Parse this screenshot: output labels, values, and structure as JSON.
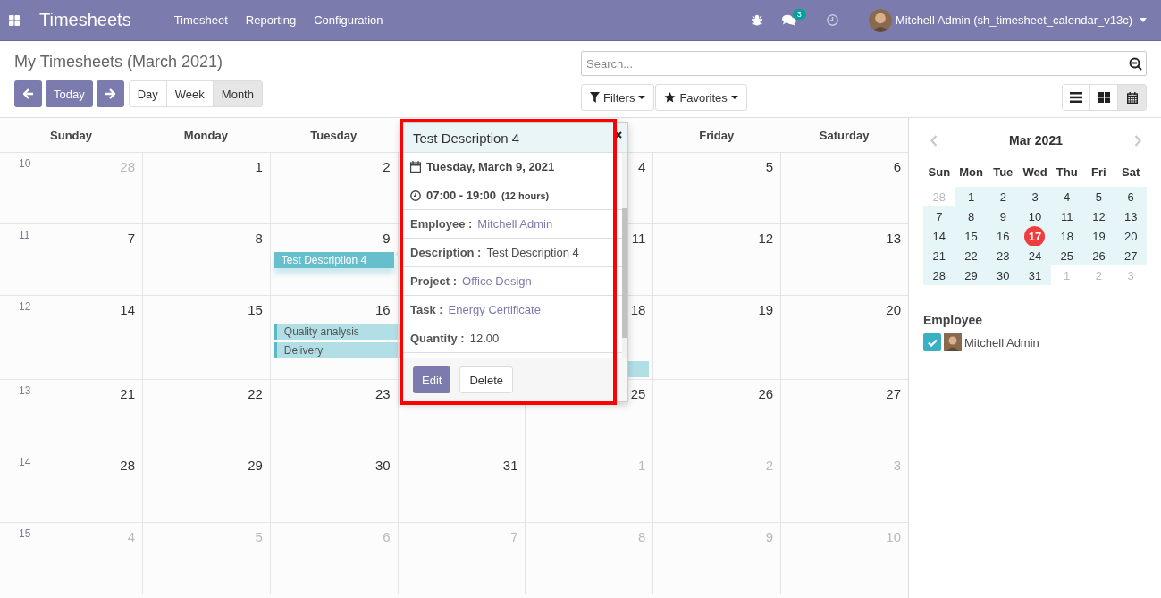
{
  "navbar": {
    "app_title": "Timesheets",
    "menu": [
      "Timesheet",
      "Reporting",
      "Configuration"
    ],
    "messages_badge": "3",
    "user": "Mitchell Admin (sh_timesheet_calendar_v13c)"
  },
  "control_panel": {
    "title": "My Timesheets (March 2021)",
    "today_button": "Today",
    "scales": [
      {
        "label": "Day",
        "selected": false
      },
      {
        "label": "Week",
        "selected": false
      },
      {
        "label": "Month",
        "selected": true
      }
    ],
    "search": {
      "placeholder": "Search..."
    },
    "filters": "Filters",
    "favorites": "Favorites",
    "views": [
      {
        "kind": "list",
        "selected": false
      },
      {
        "kind": "kanban",
        "selected": false
      },
      {
        "kind": "calendar",
        "selected": true
      }
    ]
  },
  "calendar": {
    "weekdays_before_popover": [
      "Sunday",
      "Monday",
      "Tuesday"
    ],
    "weekdays_after_popover": [
      "Friday",
      "Saturday"
    ],
    "weeks": [
      {
        "number": "10",
        "days": [
          {
            "label": "28",
            "kind": "other"
          },
          {
            "label": "1",
            "kind": "current"
          },
          {
            "label": "2",
            "kind": "current"
          },
          {
            "kind": "covered"
          },
          {
            "label": "4",
            "kind": "current"
          },
          {
            "label": "5",
            "kind": "current"
          },
          {
            "label": "6",
            "kind": "current"
          }
        ]
      },
      {
        "number": "11",
        "days": [
          {
            "label": "7",
            "kind": "current"
          },
          {
            "label": "8",
            "kind": "current"
          },
          {
            "label": "9",
            "kind": "current",
            "events": [
              {
                "title": "Test Description 4",
                "kind": "selected"
              }
            ]
          },
          {
            "kind": "covered"
          },
          {
            "label": "11",
            "kind": "current"
          },
          {
            "label": "12",
            "kind": "current"
          },
          {
            "label": "13",
            "kind": "current"
          }
        ]
      },
      {
        "number": "12",
        "days": [
          {
            "label": "14",
            "kind": "current"
          },
          {
            "label": "15",
            "kind": "current"
          },
          {
            "label": "16",
            "kind": "current",
            "events": [
              {
                "title": "Quality analysis",
                "kind": "normal"
              },
              {
                "title": "Delivery",
                "kind": "normal"
              }
            ]
          },
          {
            "kind": "covered"
          },
          {
            "label": "18",
            "kind": "current",
            "events": [
              {
                "kind": "gap"
              },
              {
                "kind": "gap"
              },
              {
                "kind": "continued"
              }
            ]
          },
          {
            "label": "19",
            "kind": "current"
          },
          {
            "label": "20",
            "kind": "current"
          }
        ]
      },
      {
        "number": "13",
        "days": [
          {
            "label": "21",
            "kind": "current"
          },
          {
            "label": "22",
            "kind": "current"
          },
          {
            "label": "23",
            "kind": "current"
          },
          {
            "kind": "covered"
          },
          {
            "label": "25",
            "kind": "current"
          },
          {
            "label": "26",
            "kind": "current"
          },
          {
            "label": "27",
            "kind": "current"
          }
        ]
      },
      {
        "number": "14",
        "days": [
          {
            "label": "28",
            "kind": "current"
          },
          {
            "label": "29",
            "kind": "current"
          },
          {
            "label": "30",
            "kind": "current"
          },
          {
            "label": "31",
            "kind": "current"
          },
          {
            "label": "1",
            "kind": "other"
          },
          {
            "label": "2",
            "kind": "other"
          },
          {
            "label": "3",
            "kind": "other"
          }
        ]
      },
      {
        "number": "15",
        "days": [
          {
            "label": "4",
            "kind": "other"
          },
          {
            "label": "5",
            "kind": "other"
          },
          {
            "label": "6",
            "kind": "other"
          },
          {
            "label": "7",
            "kind": "other"
          },
          {
            "label": "8",
            "kind": "other"
          },
          {
            "label": "9",
            "kind": "other"
          },
          {
            "label": "10",
            "kind": "other"
          }
        ]
      }
    ]
  },
  "popover": {
    "title": "Test Description 4",
    "date": "Tuesday, March 9, 2021",
    "time": "07:00 - 19:00",
    "duration": "(12 hours)",
    "fields": [
      {
        "label": "Employee :",
        "value": "Mitchell Admin",
        "kind": "link"
      },
      {
        "label": "Description :",
        "value": "Test Description 4",
        "kind": "text"
      },
      {
        "label": "Project :",
        "value": "Office Design",
        "kind": "link"
      },
      {
        "label": "Task :",
        "value": "Energy Certificate",
        "kind": "link"
      },
      {
        "label": "Quantity :",
        "value": "12.00",
        "kind": "text"
      }
    ],
    "buttons": [
      {
        "label": "Edit",
        "kind": "primary"
      },
      {
        "label": "Delete",
        "kind": "secondary"
      }
    ]
  },
  "mini_calendar": {
    "title": "Mar 2021",
    "weekdays": [
      "Sun",
      "Mon",
      "Tue",
      "Wed",
      "Thu",
      "Fri",
      "Sat"
    ],
    "weeks": [
      {
        "days": [
          {
            "label": "28",
            "kind": "other"
          },
          {
            "label": "1",
            "kind": "current"
          },
          {
            "label": "2",
            "kind": "current"
          },
          {
            "label": "3",
            "kind": "current"
          },
          {
            "label": "4",
            "kind": "current"
          },
          {
            "label": "5",
            "kind": "current"
          },
          {
            "label": "6",
            "kind": "current"
          }
        ]
      },
      {
        "days": [
          {
            "label": "7",
            "kind": "current"
          },
          {
            "label": "8",
            "kind": "current"
          },
          {
            "label": "9",
            "kind": "current"
          },
          {
            "label": "10",
            "kind": "current"
          },
          {
            "label": "11",
            "kind": "current"
          },
          {
            "label": "12",
            "kind": "current"
          },
          {
            "label": "13",
            "kind": "current"
          }
        ]
      },
      {
        "days": [
          {
            "label": "14",
            "kind": "current"
          },
          {
            "label": "15",
            "kind": "current"
          },
          {
            "label": "16",
            "kind": "current"
          },
          {
            "label": "17",
            "kind": "today"
          },
          {
            "label": "18",
            "kind": "current"
          },
          {
            "label": "19",
            "kind": "current"
          },
          {
            "label": "20",
            "kind": "current"
          }
        ]
      },
      {
        "days": [
          {
            "label": "21",
            "kind": "current"
          },
          {
            "label": "22",
            "kind": "current"
          },
          {
            "label": "23",
            "kind": "current"
          },
          {
            "label": "24",
            "kind": "current"
          },
          {
            "label": "25",
            "kind": "current"
          },
          {
            "label": "26",
            "kind": "current"
          },
          {
            "label": "27",
            "kind": "current"
          }
        ]
      },
      {
        "days": [
          {
            "label": "28",
            "kind": "current"
          },
          {
            "label": "29",
            "kind": "current"
          },
          {
            "label": "30",
            "kind": "current"
          },
          {
            "label": "31",
            "kind": "current"
          },
          {
            "label": "1",
            "kind": "other"
          },
          {
            "label": "2",
            "kind": "other"
          },
          {
            "label": "3",
            "kind": "other"
          }
        ]
      }
    ]
  },
  "employee_filter": {
    "title": "Employee",
    "items": [
      {
        "name": "Mitchell Admin",
        "checked": true
      }
    ]
  }
}
